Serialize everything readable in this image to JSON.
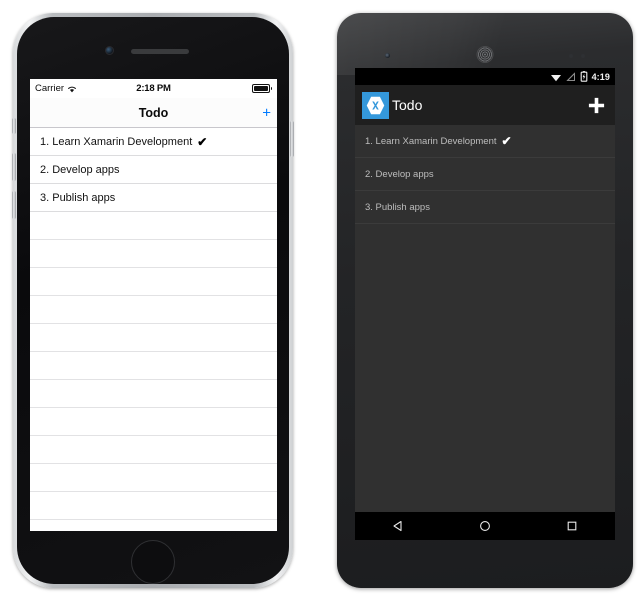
{
  "ios": {
    "status_bar": {
      "carrier": "Carrier",
      "wifi_icon": "wifi-icon",
      "time": "2:18 PM",
      "battery_icon": "battery-full-icon"
    },
    "nav_bar": {
      "title": "Todo",
      "add_label": "+",
      "add_icon": "plus-icon",
      "accent_color": "#007AFF"
    },
    "list": {
      "items": [
        {
          "text": "1. Learn Xamarin Development",
          "done": true,
          "check": "✔"
        },
        {
          "text": "2. Develop apps",
          "done": false,
          "check": ""
        },
        {
          "text": "3. Publish apps",
          "done": false,
          "check": ""
        }
      ],
      "empty_row_count": 12
    },
    "hardware": {
      "camera_icon": "front-camera-icon",
      "speaker_icon": "earpiece-speaker-icon",
      "home_button_icon": "home-button-icon",
      "silent_switch": "silent-switch",
      "volume_up": "volume-up-button",
      "volume_down": "volume-down-button",
      "power_button": "power-button"
    }
  },
  "android": {
    "status_bar": {
      "wifi_icon": "wifi-icon",
      "signal_icon": "no-sim-signal-icon",
      "battery_icon": "battery-charging-icon",
      "time": "4:19"
    },
    "action_bar": {
      "logo_icon": "xamarin-logo-icon",
      "logo_color": "#3498DB",
      "title": "Todo",
      "add_label": "+",
      "add_icon": "plus-icon"
    },
    "list": {
      "items": [
        {
          "text": "1. Learn Xamarin Development",
          "done": true,
          "check": "✔"
        },
        {
          "text": "2. Develop apps",
          "done": false,
          "check": ""
        },
        {
          "text": "3. Publish apps",
          "done": false,
          "check": ""
        }
      ]
    },
    "nav_bar": {
      "back_icon": "back-triangle-icon",
      "home_icon": "home-circle-icon",
      "recents_icon": "recents-square-icon"
    },
    "hardware": {
      "camera_icon": "front-camera-icon",
      "speaker_icon": "earpiece-speaker-icon",
      "sensor_icon": "proximity-sensor-icon"
    }
  }
}
